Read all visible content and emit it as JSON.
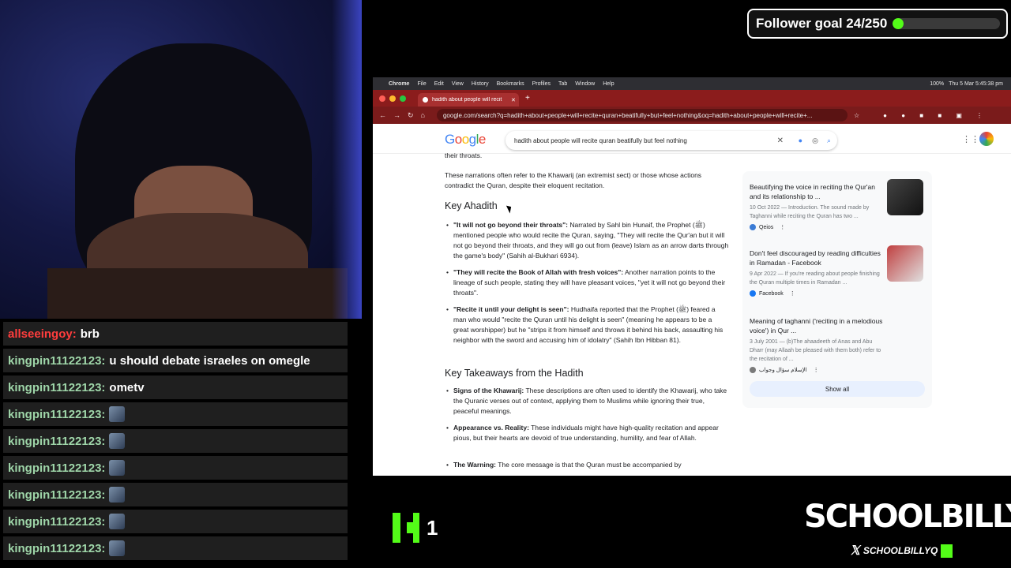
{
  "follower_goal": {
    "label": "Follower goal 24/250",
    "current": 24,
    "target": 250,
    "progress": 0.096
  },
  "chat": [
    {
      "user": "allseeingoy:",
      "user_color": "#ff3d3d",
      "message": "brb",
      "emote": false
    },
    {
      "user": "kingpin11122123:",
      "user_color": "#9fd6a9",
      "message": "u should debate israeles on omegle",
      "emote": false
    },
    {
      "user": "kingpin11122123:",
      "user_color": "#9fd6a9",
      "message": "ometv",
      "emote": false
    },
    {
      "user": "kingpin11122123:",
      "user_color": "#9fd6a9",
      "message": "",
      "emote": true
    },
    {
      "user": "kingpin11122123:",
      "user_color": "#9fd6a9",
      "message": "",
      "emote": true
    },
    {
      "user": "kingpin11122123:",
      "user_color": "#9fd6a9",
      "message": "",
      "emote": true
    },
    {
      "user": "kingpin11122123:",
      "user_color": "#9fd6a9",
      "message": "",
      "emote": true
    },
    {
      "user": "kingpin11122123:",
      "user_color": "#9fd6a9",
      "message": "",
      "emote": true
    },
    {
      "user": "kingpin11122123:",
      "user_color": "#9fd6a9",
      "message": "",
      "emote": true
    }
  ],
  "macos_menu": {
    "items": [
      "Chrome",
      "File",
      "Edit",
      "View",
      "History",
      "Bookmarks",
      "Profiles",
      "Tab",
      "Window",
      "Help"
    ],
    "battery": "100%",
    "clock": "Thu 5 Mar  5:45:38 pm"
  },
  "browser": {
    "tab_title": "hadith about people will recit",
    "url": "google.com/search?q=hadith+about+people+will+recite+quran+beatifully+but+feel+nothing&oq=hadith+about+people+will+recite+..."
  },
  "google": {
    "logo": "Google",
    "query": "hadith about people will recite quran beatifully but feel nothing"
  },
  "article": {
    "intro_tail": "their throats.",
    "intro": "These narrations often refer to the Khawarij (an extremist sect) or those whose actions contradict the Quran, despite their eloquent recitation.",
    "heading1": "Key Ahadith",
    "ahadith": [
      {
        "title": "\"It will not go beyond their throats\":",
        "text": " Narrated by Sahl bin Hunaif, the Prophet (ﷺ) mentioned people who would recite the Quran, saying, \"They will recite the Qur'an but it will not go beyond their throats, and they will go out from (leave) Islam as an arrow darts through the game's body\" (Sahih al-Bukhari 6934)."
      },
      {
        "title": "\"They will recite the Book of Allah with fresh voices\":",
        "text": " Another narration points to the lineage of such people, stating they will have pleasant voices, \"yet it will not go beyond their throats\"."
      },
      {
        "title": "\"Recite it until your delight is seen\":",
        "text": " Hudhaifa reported that the Prophet (ﷺ) feared a man who would \"recite the Quran until his delight is seen\" (meaning he appears to be a great worshipper) but he \"strips it from himself and throws it behind his back, assaulting his neighbor with the sword and accusing him of idolatry\" (Sahih Ibn Hibban 81)."
      }
    ],
    "heading2": "Key Takeaways from the Hadith",
    "takeaways": [
      {
        "title": "Signs of the Khawarij:",
        "text": " These descriptions are often used to identify the Khawarij, who take the Quranic verses out of context, applying them to Muslims while ignoring their true, peaceful meanings."
      },
      {
        "title": "Appearance vs. Reality:",
        "text": " These individuals might have high-quality recitation and appear pious, but their hearts are devoid of true understanding, humility, and fear of Allah."
      },
      {
        "title": "The Warning:",
        "text": " The core message is that the Quran must be accompanied by"
      }
    ]
  },
  "sources": [
    {
      "title": "Beautifying the voice in reciting the Qur'an and its relationship to ...",
      "snippet": "10 Oct 2022 — Introduction. The sound made by Taghanni while reciting the Quran has two ...",
      "site": "Qeios",
      "color": "#3a7bd5"
    },
    {
      "title": "Don't feel discouraged by reading difficulties in Ramadan - Facebook",
      "snippet": "9 Apr 2022 — If you're reading about people finishing the Quran multiple times in Ramadan ...",
      "site": "Facebook",
      "color": "#1877f2"
    },
    {
      "title": "Meaning of taghanni ('reciting in a melodious voice') in Qur ...",
      "snippet": "3 July 2001 — (b)The ahaadeeth of Anas and Abu Dharr (may Allaah be pleased with them both) refer to the recitation of ...",
      "site": "الإسلام سؤال وجواب",
      "color": "#7a7a7a"
    }
  ],
  "show_all": "Show all",
  "kick_viewers": "1",
  "brand": {
    "name": "SCHOOLBILLYQ",
    "handle": "SCHOOLBILLYQ"
  }
}
